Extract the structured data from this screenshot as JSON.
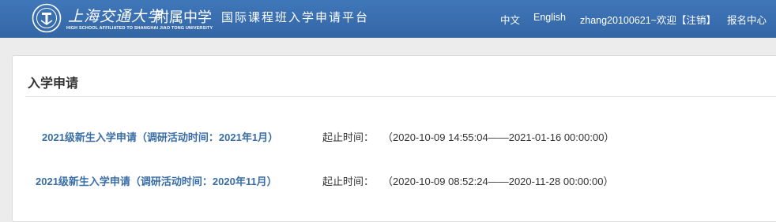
{
  "header": {
    "university_name": "上海交通大学",
    "school_suffix": "附属中学",
    "university_english": "HIGH SCHOOL AFFILIATED TO SHANGHAI JIAO TONG UNIVERSITY",
    "platform_title": "国际课程班入学申请平台",
    "lang_chinese": "中文",
    "lang_english": "English",
    "user_welcome": "zhang20100621~欢迎",
    "logout": "【注销】",
    "signup_center": "报名中心"
  },
  "main": {
    "title": "入学申请",
    "applications": [
      {
        "name": "2021级新生入学申请（调研活动时间：2021年1月）",
        "period_label": "起止时间：",
        "period": "（2020-10-09 14:55:04——2021-01-16 00:00:00）"
      },
      {
        "name": "2021级新生入学申请（调研活动时间：2020年11月）",
        "period_label": "起止时间：",
        "period": "（2020-10-09 08:52:24——2020-11-28 00:00:00）"
      }
    ]
  },
  "colors": {
    "navbar": "#3a6fb0",
    "link": "#3a6ea5"
  }
}
